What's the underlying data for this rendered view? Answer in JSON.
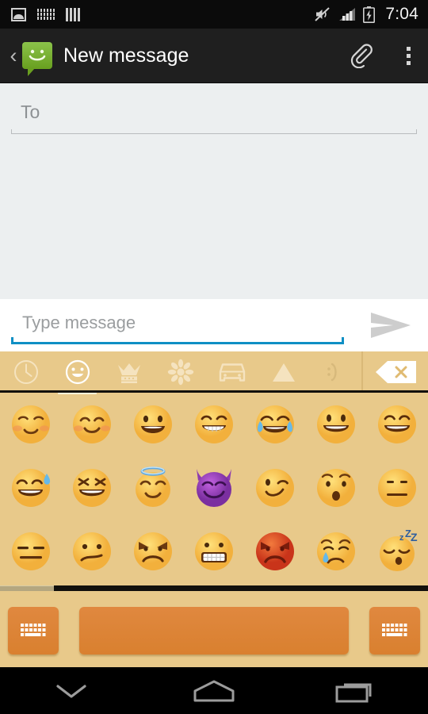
{
  "statusbar": {
    "time": "7:04",
    "left_icons": [
      {
        "name": "screenshot-icon",
        "label": "screenshot"
      },
      {
        "name": "keyboard-icon",
        "label": "keyboard active"
      },
      {
        "name": "sim-bars-icon",
        "label": "sim bars"
      }
    ],
    "right_icons": [
      {
        "name": "volume-mute-icon",
        "label": "silent"
      },
      {
        "name": "signal-bars-icon",
        "label": "signal"
      },
      {
        "name": "battery-charging-icon",
        "label": "battery charging"
      }
    ]
  },
  "appbar": {
    "back_label": "‹",
    "app_icon": "messaging-icon",
    "title": "New message",
    "attach_label": "attach",
    "overflow_label": "more options"
  },
  "compose": {
    "to_placeholder": "To",
    "to_value": "",
    "message_placeholder": "Type message",
    "message_value": "",
    "send_label": "send"
  },
  "keyboard": {
    "background_color": "#e8c98a",
    "key_color": "#dd8534",
    "accent_color": "#fdf2d8",
    "tabs": [
      {
        "name": "tab-recent",
        "icon": "clock-icon",
        "label": "Recent",
        "active": false,
        "faded": false
      },
      {
        "name": "tab-smileys",
        "icon": "smiley-icon",
        "label": "Smileys",
        "active": true,
        "faded": false
      },
      {
        "name": "tab-objects",
        "icon": "crown-icon",
        "label": "Objects",
        "active": false,
        "faded": false
      },
      {
        "name": "tab-nature",
        "icon": "flower-icon",
        "label": "Nature",
        "active": false,
        "faded": false
      },
      {
        "name": "tab-places",
        "icon": "car-icon",
        "label": "Places",
        "active": false,
        "faded": false
      },
      {
        "name": "tab-symbols",
        "icon": "triangle-icon",
        "label": "Symbols",
        "active": false,
        "faded": false
      },
      {
        "name": "tab-emoticons",
        "icon": "emoticon-icon",
        "label": "Emoticons",
        "active": false,
        "faded": true
      }
    ],
    "delete_key": {
      "name": "backspace-key",
      "label": "delete"
    },
    "emoji_rows": [
      [
        {
          "glyph": "☺️",
          "name": "emoji-relaxed"
        },
        {
          "glyph": "😊",
          "name": "emoji-blush"
        },
        {
          "glyph": "😃",
          "name": "emoji-smiley"
        },
        {
          "glyph": "😁",
          "name": "emoji-grin"
        },
        {
          "glyph": "😂",
          "name": "emoji-joy"
        },
        {
          "glyph": "😀",
          "name": "emoji-grinning"
        },
        {
          "glyph": "😄",
          "name": "emoji-smile"
        }
      ],
      [
        {
          "glyph": "😅",
          "name": "emoji-sweat-smile"
        },
        {
          "glyph": "😆",
          "name": "emoji-laughing"
        },
        {
          "glyph": "😇",
          "name": "emoji-innocent"
        },
        {
          "glyph": "😈",
          "name": "emoji-smiling-imp"
        },
        {
          "glyph": "😉",
          "name": "emoji-wink"
        },
        {
          "glyph": "😯",
          "name": "emoji-hushed"
        },
        {
          "glyph": "😐",
          "name": "emoji-neutral-face"
        }
      ],
      [
        {
          "glyph": "😑",
          "name": "emoji-expressionless"
        },
        {
          "glyph": "😕",
          "name": "emoji-confused"
        },
        {
          "glyph": "😠",
          "name": "emoji-angry"
        },
        {
          "glyph": "😬",
          "name": "emoji-grimacing"
        },
        {
          "glyph": "😡",
          "name": "emoji-rage"
        },
        {
          "glyph": "😢",
          "name": "emoji-cry"
        },
        {
          "glyph": "😴",
          "name": "emoji-sleeping"
        }
      ]
    ],
    "bottom_keys": [
      {
        "name": "keyboard-switch-key-left",
        "icon": "keyboard-icon",
        "label": "keyboard"
      },
      {
        "name": "space-key",
        "icon": "",
        "label": ""
      },
      {
        "name": "keyboard-switch-key-right",
        "icon": "keyboard-icon",
        "label": "keyboard"
      }
    ],
    "page_indicator": {
      "pages": 8,
      "current": 1
    }
  },
  "navbar": [
    {
      "name": "nav-hide-keyboard",
      "icon": "chevron-down-icon",
      "label": "Hide keyboard"
    },
    {
      "name": "nav-home",
      "icon": "home-icon",
      "label": "Home"
    },
    {
      "name": "nav-recents",
      "icon": "recents-icon",
      "label": "Recents"
    }
  ]
}
